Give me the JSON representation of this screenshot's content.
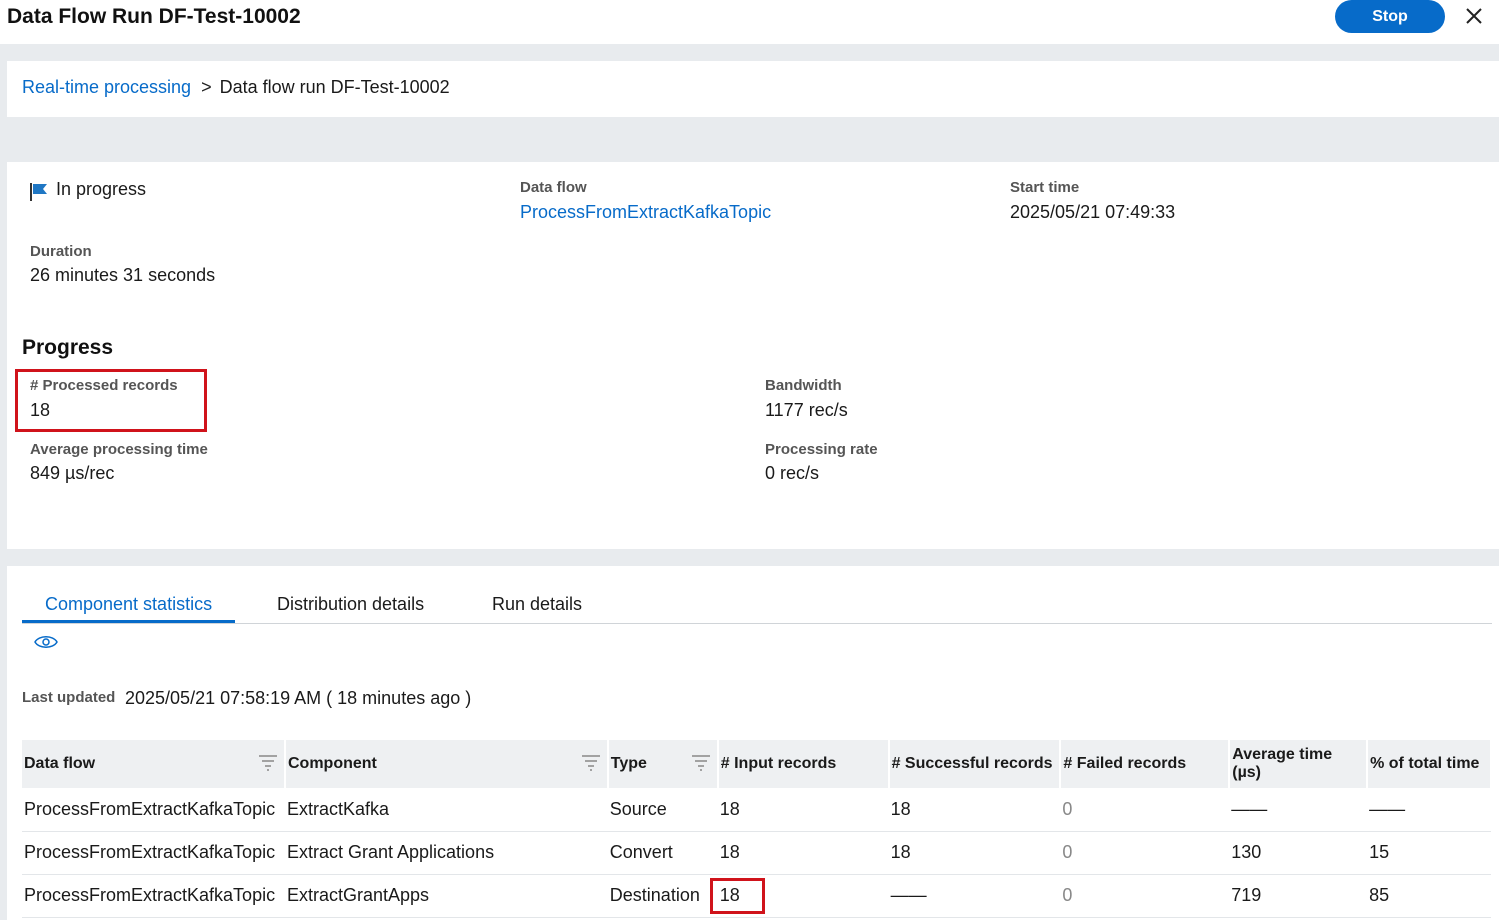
{
  "header": {
    "title": "Data Flow Run DF-Test-10002",
    "stop_label": "Stop"
  },
  "breadcrumb": {
    "parent": "Real-time processing",
    "separator": ">",
    "current": "Data flow run DF-Test-10002"
  },
  "summary": {
    "status": "In progress",
    "data_flow_label": "Data flow",
    "data_flow_value": "ProcessFromExtractKafkaTopic",
    "start_time_label": "Start time",
    "start_time_value": "2025/05/21 07:49:33",
    "duration_label": "Duration",
    "duration_value": "26 minutes 31 seconds"
  },
  "progress": {
    "title": "Progress",
    "processed_label": "# Processed records",
    "processed_value": "18",
    "bandwidth_label": "Bandwidth",
    "bandwidth_value": "1177 rec/s",
    "avg_time_label": "Average processing time",
    "avg_time_value": "849 µs/rec",
    "rate_label": "Processing rate",
    "rate_value": "0 rec/s"
  },
  "tabs": [
    {
      "label": "Component statistics",
      "active": true
    },
    {
      "label": "Distribution details",
      "active": false
    },
    {
      "label": "Run details",
      "active": false
    }
  ],
  "last_updated": {
    "label": "Last updated",
    "value": "2025/05/21 07:58:19 AM ( 18 minutes ago )"
  },
  "table": {
    "columns": [
      "Data flow",
      "Component",
      "Type",
      "# Input records",
      "# Successful records",
      "# Failed records",
      "Average time (µs)",
      "% of total time"
    ],
    "rows": [
      [
        "ProcessFromExtractKafkaTopic",
        "ExtractKafka",
        "Source",
        "18",
        "18",
        "0",
        "——",
        "——"
      ],
      [
        "ProcessFromExtractKafkaTopic",
        "Extract Grant Applications",
        "Convert",
        "18",
        "18",
        "0",
        "130",
        "15"
      ],
      [
        "ProcessFromExtractKafkaTopic",
        "ExtractGrantApps",
        "Destination",
        "18",
        "——",
        "0",
        "719",
        "85"
      ]
    ]
  },
  "colors": {
    "accent": "#076bc9",
    "highlight": "#d0131b",
    "background": "#e8ebee"
  }
}
